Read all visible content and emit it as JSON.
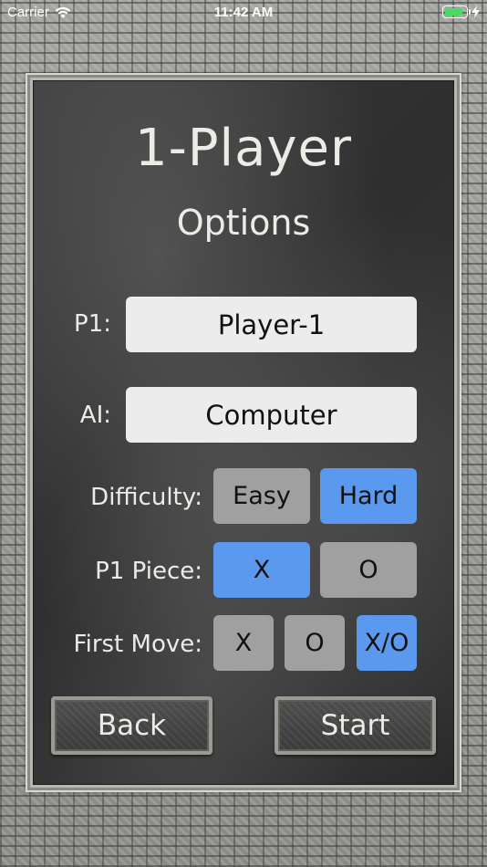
{
  "status_bar": {
    "carrier": "Carrier",
    "time": "11:42 AM",
    "battery_color": "#4cd964"
  },
  "screen": {
    "title": "1-Player",
    "subtitle": "Options"
  },
  "players": {
    "p1_label": "P1:",
    "p1_value": "Player-1",
    "ai_label": "AI:",
    "ai_value": "Computer"
  },
  "difficulty": {
    "label": "Difficulty:",
    "options": [
      "Easy",
      "Hard"
    ],
    "selected": "Hard"
  },
  "p1_piece": {
    "label": "P1 Piece:",
    "options": [
      "X",
      "O"
    ],
    "selected": "X"
  },
  "first_move": {
    "label": "First Move:",
    "options": [
      "X",
      "O",
      "X/O"
    ],
    "selected": "X/O"
  },
  "actions": {
    "back_label": "Back",
    "start_label": "Start"
  },
  "colors": {
    "selected": "#5a99ee",
    "unselected": "#a0a0a0",
    "chalk": "#ecece6"
  },
  "icons": [
    "wifi-icon",
    "battery-icon",
    "charging-bolt-icon"
  ]
}
